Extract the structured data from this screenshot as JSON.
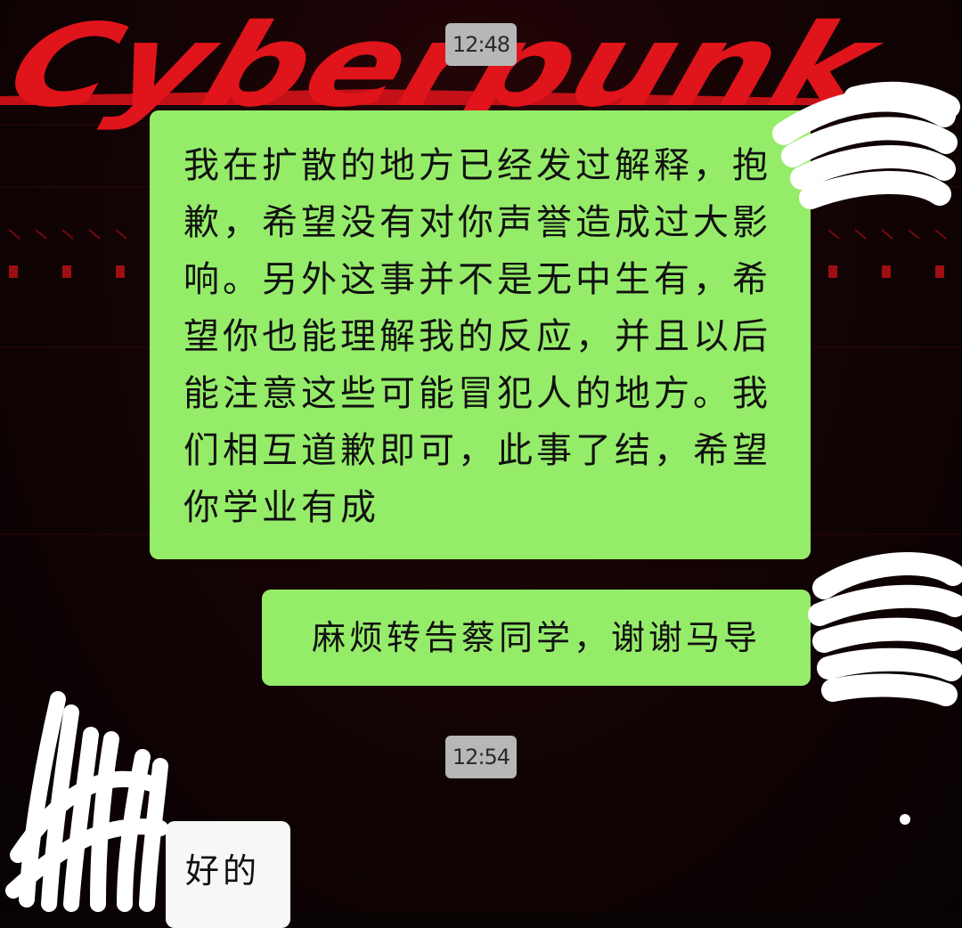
{
  "wallpaper": {
    "logo_text": "Cyberpunk",
    "logo_color": "#e0141b",
    "background_color": "#0a0304"
  },
  "chat": {
    "timestamps": [
      "12:48",
      "12:54"
    ],
    "messages": [
      {
        "side": "sent",
        "bubble_color": "#95ec69",
        "text": "我在扩散的地方已经发过解释，抱歉，希望没有对你声誉造成过大影响。另外这事并不是无中生有，希望你也能理解我的反应，并且以后能注意这些可能冒犯人的地方。我们相互道歉即可，此事了结，希望你学业有成"
      },
      {
        "side": "sent",
        "bubble_color": "#95ec69",
        "text": "麻烦转告蔡同学，谢谢马导"
      },
      {
        "side": "received",
        "bubble_color": "#f7f7f7",
        "text": "好的"
      }
    ]
  }
}
